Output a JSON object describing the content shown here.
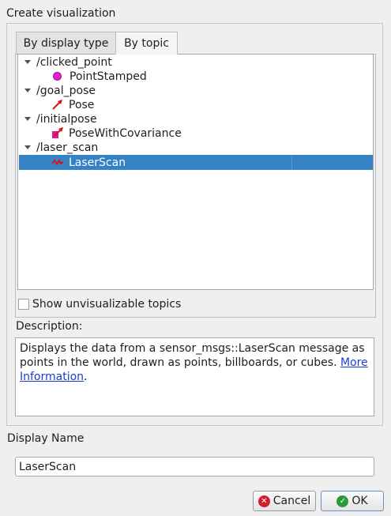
{
  "dialog": {
    "title": "Create visualization"
  },
  "tabs": [
    {
      "label": "By display type",
      "active": false
    },
    {
      "label": "By topic",
      "active": true
    }
  ],
  "tree": {
    "topics": [
      {
        "name": "/clicked_point",
        "expanded": true,
        "child": {
          "label": "PointStamped",
          "icon": "point-stamped-icon",
          "selected": false
        }
      },
      {
        "name": "/goal_pose",
        "expanded": true,
        "child": {
          "label": "Pose",
          "icon": "pose-arrow-icon",
          "selected": false
        }
      },
      {
        "name": "/initialpose",
        "expanded": true,
        "child": {
          "label": "PoseWithCovariance",
          "icon": "pose-covariance-icon",
          "selected": false
        }
      },
      {
        "name": "/laser_scan",
        "expanded": true,
        "child": {
          "label": "LaserScan",
          "icon": "laser-scan-icon",
          "selected": true
        }
      }
    ]
  },
  "show_unvisualizable": {
    "label": "Show unvisualizable topics",
    "checked": false
  },
  "description": {
    "label": "Description:",
    "text": "Displays the data from a sensor_msgs::LaserScan message as points in the world, drawn as points, billboards, or cubes. ",
    "link_text": "More Information",
    "suffix": "."
  },
  "display_name": {
    "label": "Display Name",
    "value": "LaserScan"
  },
  "buttons": {
    "cancel": "Cancel",
    "ok": "OK"
  },
  "colors": {
    "selection": "#3583c5",
    "link": "#1a3cd8",
    "point_icon": "#e020d0",
    "arrow_icon": "#e01010",
    "cancel_icon": "#d0202a",
    "ok_icon": "#2a9a3a"
  }
}
